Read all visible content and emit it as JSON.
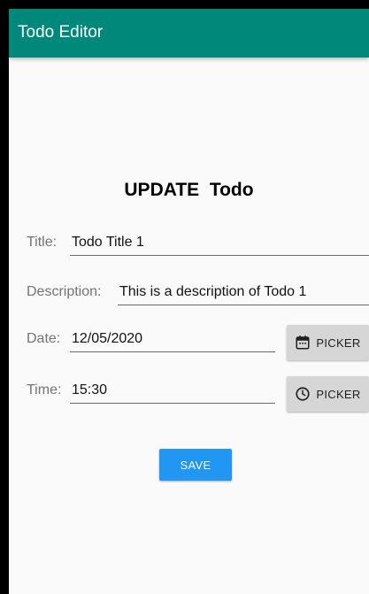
{
  "app_bar": {
    "title": "Todo Editor",
    "color": "#00897b"
  },
  "form": {
    "heading": "UPDATE  Todo",
    "fields": {
      "title": {
        "label": "Title:",
        "value": "Todo Title 1"
      },
      "description": {
        "label": "Description:",
        "value": "This is a description of Todo 1"
      },
      "date": {
        "label": "Date:",
        "value": "12/05/2020"
      },
      "time": {
        "label": "Time:",
        "value": "15:30"
      }
    },
    "date_picker": {
      "label": "PICKER",
      "icon": "calendar-icon"
    },
    "time_picker": {
      "label": "PICKER",
      "icon": "clock-icon"
    },
    "save_button": {
      "label": "SAVE",
      "color": "#2196f3"
    }
  }
}
